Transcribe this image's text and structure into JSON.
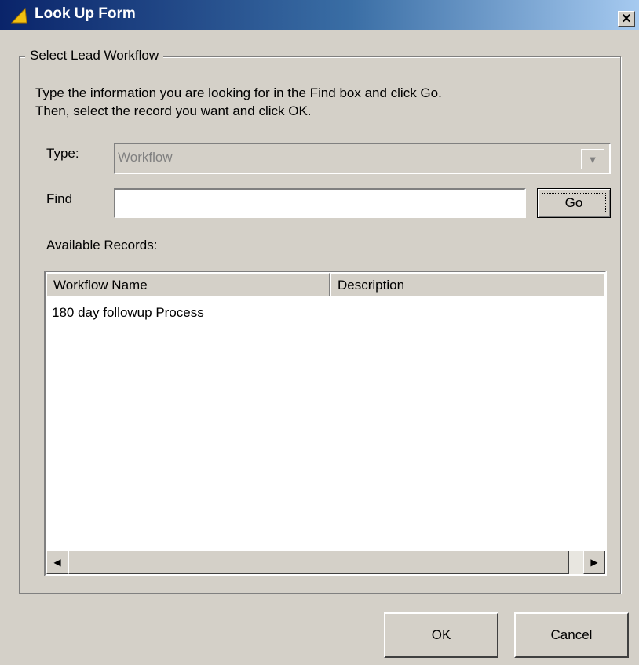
{
  "window": {
    "title": "Look Up Form",
    "close_label": "✕"
  },
  "group": {
    "label": "Select Lead Workflow",
    "instructions": [
      "Type the information you are looking for in the Find box and click Go.",
      "Then, select the record you want and click OK."
    ]
  },
  "type": {
    "label": "Type:",
    "value": "Workflow",
    "disabled": true
  },
  "find": {
    "label": "Find",
    "value": "",
    "go_label": "Go"
  },
  "records": {
    "label": "Available Records:",
    "columns": [
      "Workflow Name",
      "Description"
    ],
    "rows": [
      [
        "180 day followup Process",
        ""
      ]
    ]
  },
  "buttons": {
    "ok": "OK",
    "cancel": "Cancel"
  },
  "colors": {
    "title_start": "#0a246a",
    "title_end": "#a6caf0",
    "face": "#d4d0c8"
  }
}
